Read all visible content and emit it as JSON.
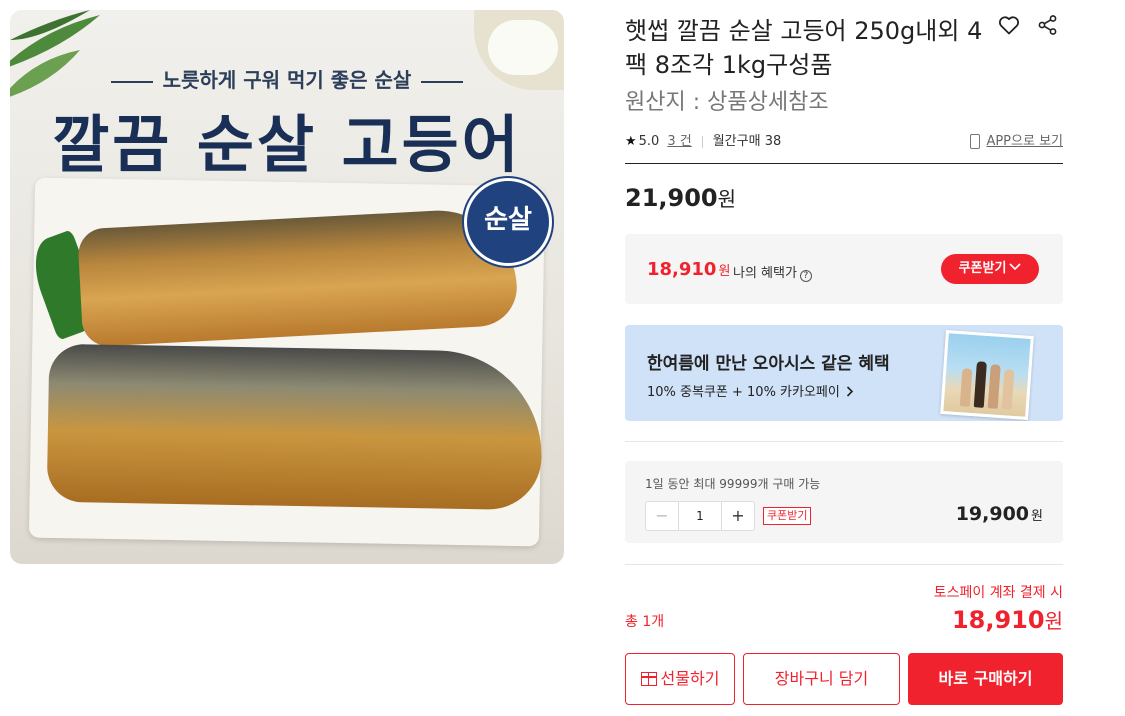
{
  "product_image": {
    "tagline": "노릇하게 구워 먹기 좋은 순살",
    "headline": "깔끔 순살 고등어",
    "badge": "순살"
  },
  "product": {
    "title": "햇썹 깔끔 순살 고등어 250g내외 4팩 8조각 1kg구성품",
    "origin": "원산지 : 상품상세참조"
  },
  "icons": {
    "favorite": "heart-icon",
    "share": "share-icon",
    "rating": "star-icon",
    "app": "phone-icon"
  },
  "meta": {
    "star": "★",
    "rating": "5.0",
    "review_count": "3 건",
    "monthly_purchase": "월간구매 38",
    "app_link": "APP으로 보기"
  },
  "price": {
    "amount": "21,900",
    "unit": "원"
  },
  "benefit": {
    "price": "18,910",
    "unit": "원",
    "label": "나의 혜택가",
    "coupon_button": "쿠폰받기"
  },
  "banner": {
    "title": "한여름에 만난 오아시스 같은 혜택",
    "subtitle": "10% 중복쿠폰 + 10% 카카오페이"
  },
  "quantity": {
    "limit_prefix": "1일 동안",
    "limit_max": "최대 99999개",
    "limit_suffix": "구매 가능",
    "minus": "−",
    "value": "1",
    "plus": "+",
    "coupon_tag": "쿠폰받기",
    "line_price": "19,900",
    "unit": "원"
  },
  "total": {
    "toss_label": "토스페이 계좌 결제 시",
    "count_label": "총 1개",
    "price": "18,910",
    "unit": "원"
  },
  "actions": {
    "gift": "선물하기",
    "cart": "장바구니 담기",
    "buy": "바로 구매하기"
  },
  "colors": {
    "accent": "#f0222d",
    "banner_bg": "#cfe2f8",
    "panel_bg": "#f5f5f5"
  }
}
